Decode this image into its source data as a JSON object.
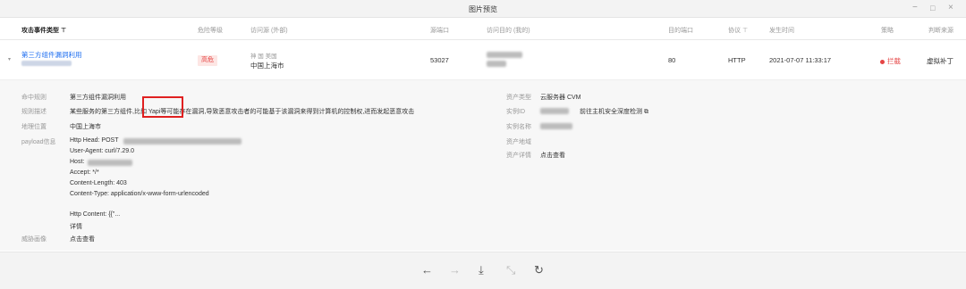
{
  "window": {
    "title": "图片预览",
    "minimize": "−",
    "maximize": "□",
    "close": "×"
  },
  "table": {
    "headers": {
      "event_type": "攻击事件类型",
      "risk": "危险等级",
      "source": "访问源 (外部)",
      "src_port": "源端口",
      "target": "访问目的 (我的)",
      "dst_port": "目的端口",
      "protocol": "协议",
      "time": "发生时间",
      "strategy": "策略",
      "judge": "判断来源"
    },
    "row": {
      "event_type": "第三方组件漏洞利用",
      "risk": "高危",
      "source_line1": "神 国 美国",
      "source_line2": "中国上海市",
      "src_port": "53027",
      "dst_port": "80",
      "protocol": "HTTP",
      "time": "2021-07-07 11:33:17",
      "strategy": "拦截",
      "judge": "虚拟补丁"
    }
  },
  "detail": {
    "hit_rule_label": "命中规则",
    "hit_rule": "第三方组件漏洞利用",
    "rule_desc_label": "规则描述",
    "rule_desc": "某些服务的第三方组件,比如 Yapi等可能存在漏洞,导致恶意攻击者的可能基于该漏洞来得到计算机的控制权,进而发起恶意攻击",
    "geo_label": "地理位置",
    "geo": "中国上海市",
    "payload_label": "payload信息",
    "payload_lines": [
      "Http Head: POST",
      "User-Agent: curl/7.29.0",
      "Host:",
      "Accept: */*",
      "Content-Length: 403",
      "Content-Type: application/x-www-form-urlencoded"
    ],
    "http_content": "Http Content: {{\"...",
    "details_link": "详情",
    "defense_label": "威胁画像",
    "defense_link": "点击查看",
    "asset_type_label": "资产类型",
    "asset_type": "云服务器 CVM",
    "instance_id_label": "实例ID",
    "instance_link": "前往主机安全深度检测",
    "instance_name_label": "实例名称",
    "asset_region_label": "资产地域",
    "asset_detail_label": "资产详情",
    "asset_detail_link": "点击查看"
  },
  "footer": {
    "prev": "←",
    "next": "→",
    "download": "⤓",
    "fullscreen": "⤡",
    "rotate": "↻"
  }
}
